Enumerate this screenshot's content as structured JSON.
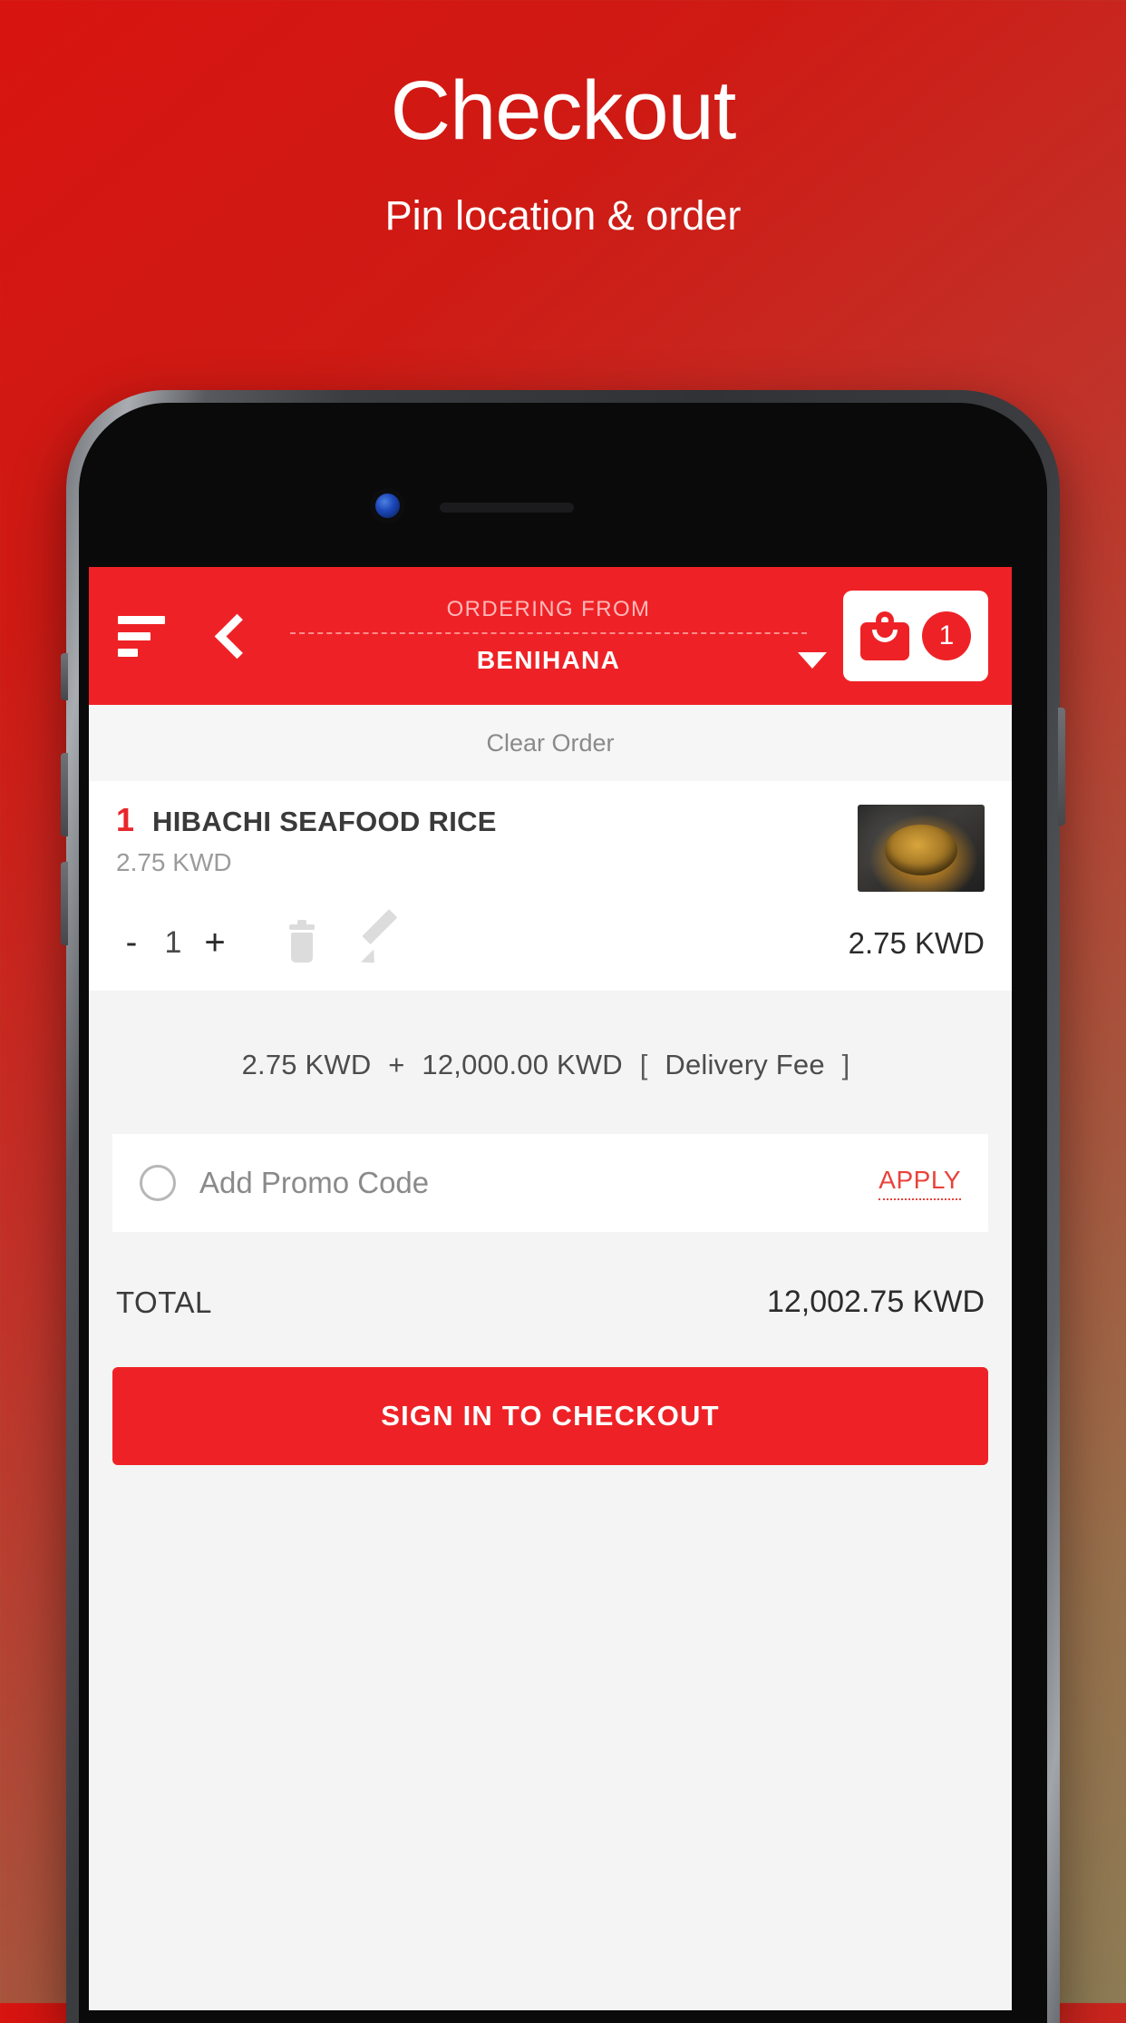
{
  "promo_banner": {
    "title": "Checkout",
    "subtitle": "Pin location & order"
  },
  "colors": {
    "brand_red": "#ee2226",
    "accent_red": "#e8433b",
    "background_top": "#d81410",
    "background_bottom": "#8d7c55",
    "screen_bg": "#f4f4f4"
  },
  "appbar": {
    "menu_icon": "hamburger-icon",
    "back_icon": "back-chevron-icon",
    "ordering_from_label": "ORDERING FROM",
    "restaurant_name": "BENIHANA",
    "dropdown_icon": "caret-down-icon",
    "cart_icon": "shopping-bag-icon",
    "cart_count": "1"
  },
  "order": {
    "clear_order_label": "Clear Order",
    "items": [
      {
        "qty_badge": "1",
        "name": "HIBACHI SEAFOOD RICE",
        "unit_price": "2.75 KWD",
        "minus_label": "-",
        "qty": "1",
        "plus_label": "+",
        "delete_icon": "trash-icon",
        "edit_icon": "pencil-icon",
        "line_total": "2.75 KWD",
        "thumbnail": "hibachi-seafood-rice-photo"
      }
    ],
    "breakdown": {
      "subtotal": "2.75 KWD",
      "operator": "+",
      "delivery_amount": "12,000.00 KWD",
      "bracket_open": "[",
      "delivery_label": "Delivery Fee",
      "bracket_close": "]"
    },
    "promo": {
      "radio_icon": "radio-circle-icon",
      "placeholder": "Add Promo Code",
      "value": "",
      "apply_label": "APPLY"
    },
    "total": {
      "label": "TOTAL",
      "value": "12,002.75 KWD"
    },
    "checkout_button_label": "SIGN IN TO CHECKOUT"
  }
}
